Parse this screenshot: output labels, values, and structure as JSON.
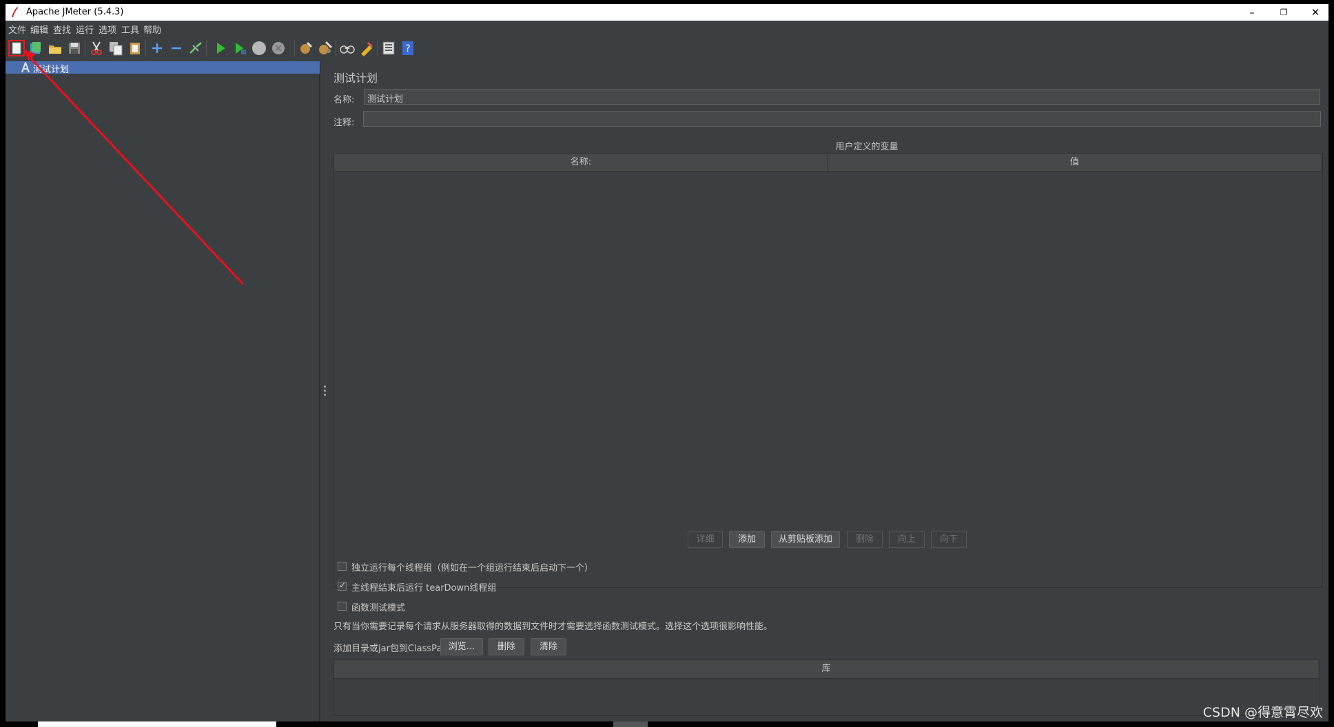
{
  "window": {
    "title": "Apache JMeter (5.4.3)",
    "minimize": "–",
    "restore": "❐",
    "close": "✕"
  },
  "menu": [
    "文件",
    "编辑",
    "查找",
    "运行",
    "选项",
    "工具",
    "帮助"
  ],
  "toolbar": {
    "icons": [
      "new-icon",
      "templates-icon",
      "open-icon",
      "save-icon",
      "cut-icon",
      "copy-icon",
      "paste-icon",
      "expand-icon",
      "collapse-icon",
      "toggle-icon",
      "start-icon",
      "start-no-pause-icon",
      "stop-icon",
      "shutdown-icon",
      "clear-icon",
      "clear-all-icon",
      "search-icon",
      "reset-search-icon",
      "function-helper-icon",
      "help-icon"
    ]
  },
  "tree": {
    "root_label": "测试计划"
  },
  "panel": {
    "heading": "测试计划",
    "name_label": "名称:",
    "name_value": "测试计划",
    "comment_label": "注释:",
    "comment_value": "",
    "variables_title": "用户定义的变量",
    "col_name": "名称:",
    "col_value": "值",
    "buttons": {
      "detail": "详细",
      "add": "添加",
      "add_from_clipboard": "从剪贴板添加",
      "delete": "删除",
      "up": "向上",
      "down": "向下"
    },
    "checkboxes": {
      "serialize": "独立运行每个线程组（例如在一个组运行结束后启动下一个）",
      "teardown": "主线程结束后运行 tearDown线程组",
      "functional": "函数测试模式"
    },
    "functional_note": "只有当你需要记录每个请求从服务器取得的数据到文件时才需要选择函数测试模式。选择这个选项很影响性能。",
    "classpath_label": "添加目录或jar包到ClassPath",
    "browse_button": "浏览...",
    "delete_button": "删除",
    "clear_button": "清除",
    "library_header": "库"
  },
  "watermark": "CSDN @得意霄尽欢",
  "colors": {
    "background": "#3c3f41",
    "selection": "#4b6eaf",
    "annotation": "#e8111c"
  }
}
